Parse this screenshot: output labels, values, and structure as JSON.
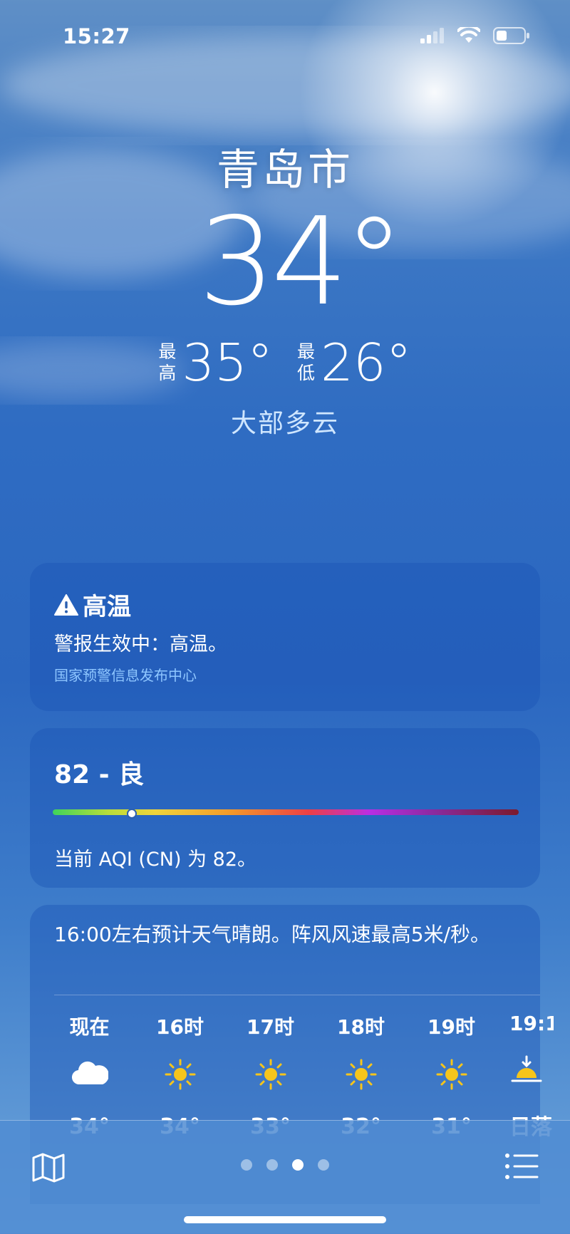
{
  "status": {
    "time": "15:27"
  },
  "location": {
    "city": "青岛市",
    "temperature": "34°",
    "high_label_1": "最",
    "high_label_2": "高",
    "high": "35°",
    "low_label_1": "最",
    "low_label_2": "低",
    "low": "26°",
    "condition": "大部多云"
  },
  "alert": {
    "title": "高温",
    "body": "警报生效中：高温。",
    "source": "国家预警信息发布中心"
  },
  "aqi": {
    "value_text": "82 - 良",
    "description": "当前 AQI (CN) 为 82。",
    "level_fraction": 0.17
  },
  "hourly": {
    "summary": "16:00左右预计天气晴朗。阵风风速最高5米/秒。",
    "items": [
      {
        "label": "现在",
        "icon": "cloud-icon",
        "temp": "34°"
      },
      {
        "label": "16时",
        "icon": "sun-icon",
        "temp": "34°"
      },
      {
        "label": "17时",
        "icon": "sun-icon",
        "temp": "33°"
      },
      {
        "label": "18时",
        "icon": "sun-icon",
        "temp": "32°"
      },
      {
        "label": "19时",
        "icon": "sun-icon",
        "temp": "31°"
      },
      {
        "label": "19:1",
        "icon": "sunset-icon",
        "temp": "日落"
      }
    ]
  },
  "pager": {
    "page_count": 4,
    "active_index": 2
  },
  "colors": {
    "condition_text": "#cfe6ff",
    "alert_source": "#8ec6ff",
    "sun_icon": "#f6c51b"
  }
}
